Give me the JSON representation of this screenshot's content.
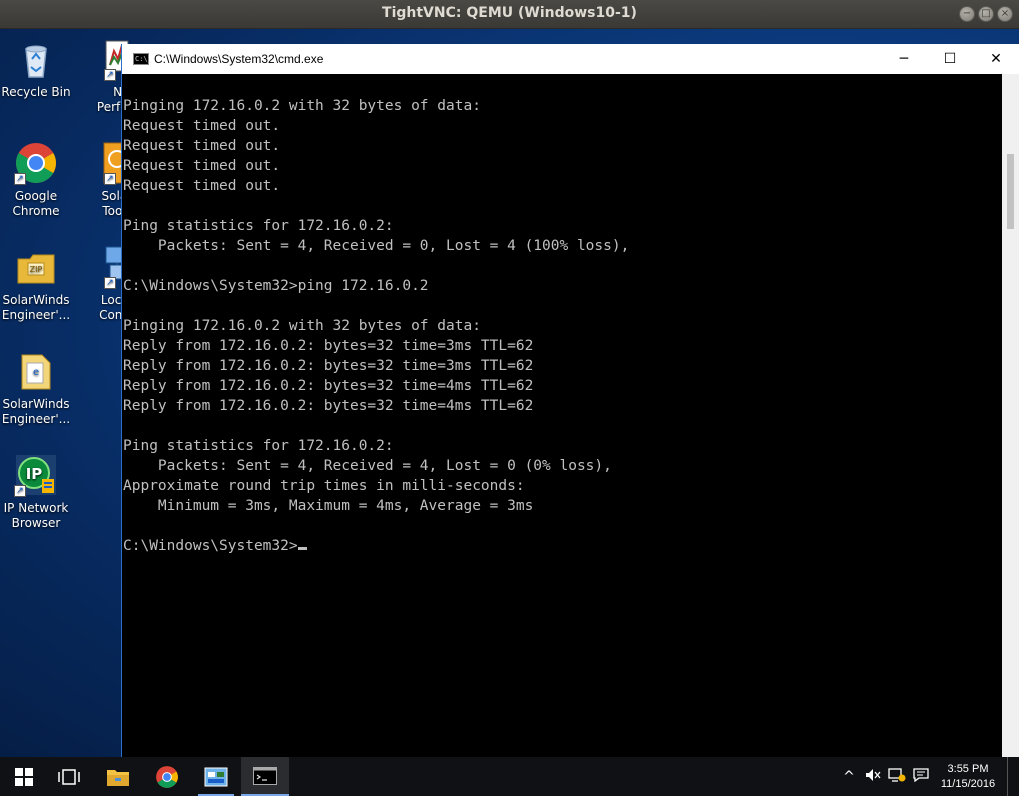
{
  "vnc": {
    "title": "TightVNC: QEMU (Windows10-1)",
    "minimize_glyph": "−",
    "maximize_glyph": "□",
    "close_glyph": "×"
  },
  "desktop": {
    "icons": [
      {
        "label": "Recycle Bin",
        "icon": "recycle-bin-icon"
      },
      {
        "label": "Google Chrome",
        "icon": "chrome-icon"
      },
      {
        "label": "SolarWinds Engineer'...",
        "icon": "zip-folder-icon"
      },
      {
        "label": "SolarWinds Engineer'...",
        "icon": "document-folder-icon"
      },
      {
        "label": "IP Network Browser",
        "icon": "ip-network-icon"
      },
      {
        "label": "Netw Perform",
        "icon": "network-performance-icon"
      },
      {
        "label": "SolarW Toolset",
        "icon": "solarwinds-toolset-icon"
      },
      {
        "label": "Local A Connec",
        "icon": "local-area-connection-icon"
      }
    ]
  },
  "cmd": {
    "title": "C:\\Windows\\System32\\cmd.exe",
    "icon_text": "C:\\_",
    "minimize_glyph": "─",
    "maximize_glyph": "☐",
    "close_glyph": "✕",
    "lines": [
      "Pinging 172.16.0.2 with 32 bytes of data:",
      "Request timed out.",
      "Request timed out.",
      "Request timed out.",
      "Request timed out.",
      "",
      "Ping statistics for 172.16.0.2:",
      "    Packets: Sent = 4, Received = 0, Lost = 4 (100% loss),",
      "",
      "C:\\Windows\\System32>ping 172.16.0.2",
      "",
      "Pinging 172.16.0.2 with 32 bytes of data:",
      "Reply from 172.16.0.2: bytes=32 time=3ms TTL=62",
      "Reply from 172.16.0.2: bytes=32 time=3ms TTL=62",
      "Reply from 172.16.0.2: bytes=32 time=4ms TTL=62",
      "Reply from 172.16.0.2: bytes=32 time=4ms TTL=62",
      "",
      "Ping statistics for 172.16.0.2:",
      "    Packets: Sent = 4, Received = 4, Lost = 0 (0% loss),",
      "Approximate round trip times in milli-seconds:",
      "    Minimum = 3ms, Maximum = 4ms, Average = 3ms",
      ""
    ],
    "prompt": "C:\\Windows\\System32>"
  },
  "taskbar": {
    "items": [
      "start-icon",
      "task-view-icon",
      "file-explorer-icon",
      "chrome-icon",
      "network-tool-icon",
      "cmd-icon"
    ],
    "tray": {
      "chevron": "^",
      "time": "3:55 PM",
      "date": "11/15/2016"
    }
  },
  "colors": {
    "console_text": "#c0c0c0",
    "console_bg": "#000000",
    "taskbar_accent": "#78a8e8"
  }
}
